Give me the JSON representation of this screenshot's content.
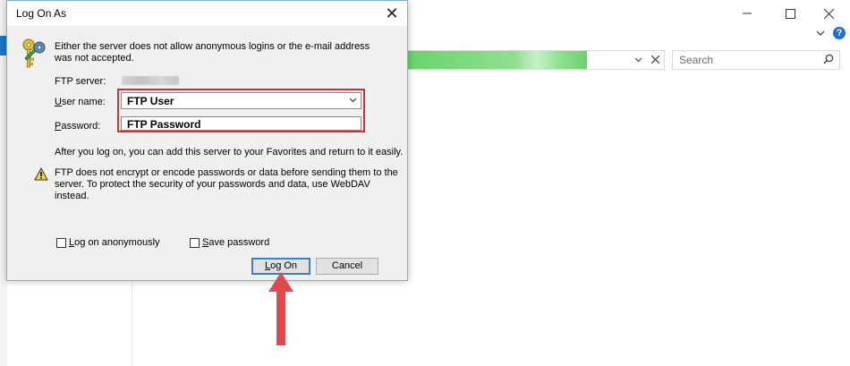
{
  "explorer": {
    "search_placeholder": "Search",
    "help_label": "?",
    "colors": {
      "progress_green": "#69d36b",
      "accent_blue": "#1e74c8"
    },
    "address_load_progress": 0.7
  },
  "dialog": {
    "title": "Log On As",
    "close_glyph": "✕",
    "message": "Either the server does not allow anonymous logins or the e-mail address was not accepted.",
    "ftp_server_label": "FTP server:",
    "user_label_u": "U",
    "user_label_rest": "ser name:",
    "password_label_u": "P",
    "password_label_rest": "assword:",
    "user_value": "FTP User",
    "password_value": "FTP Password",
    "after_logon_text": "After you log on, you can add this server to your Favorites and return to it easily.",
    "warning_text": "FTP does not encrypt or encode passwords or data before sending them to the server.  To protect the security of your passwords and data, use WebDAV instead.",
    "anon_label_u": "L",
    "anon_label_rest": "og on anonymously",
    "save_label_u": "S",
    "save_label_rest": "ave password",
    "logon_button_u": "L",
    "logon_button_rest": "og On",
    "cancel_button": "Cancel",
    "anon_checked": false,
    "save_checked": false,
    "icons": [
      "keys-icon",
      "warning-icon",
      "close-icon",
      "chevron-down-icon"
    ]
  },
  "annotation": {
    "highlight_color": "#d63030",
    "arrow_color": "#e04a4a"
  }
}
